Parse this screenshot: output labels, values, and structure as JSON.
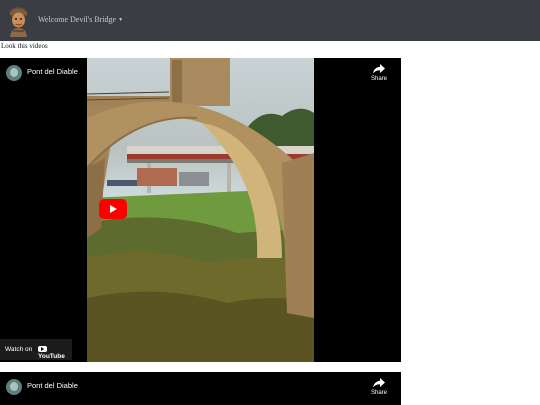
{
  "navbar": {
    "welcome_label": "Welcome",
    "dropdown_label": "Devil's Bridge",
    "dropdown_caret": "▼"
  },
  "content": {
    "intro_text": "Look this videos"
  },
  "videos": [
    {
      "title": "Pont del Diable",
      "share_label": "Share",
      "watch_on_label": "Watch on",
      "youtube_label": "YouTube"
    },
    {
      "title": "Pont del Diable",
      "share_label": "Share"
    }
  ],
  "colors": {
    "navbar_bg": "#3a3d44",
    "nav_text": "#c9c9c9",
    "play_button": "#ff0000"
  }
}
